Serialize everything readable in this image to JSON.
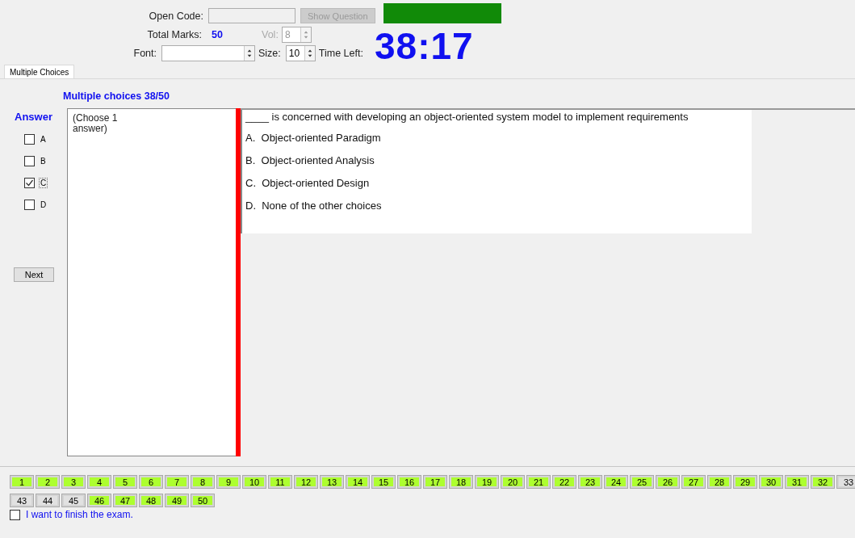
{
  "header": {
    "open_code": {
      "label": "Open Code:"
    },
    "show_question": {
      "label": "Show Question",
      "disabled": true
    },
    "total_marks": {
      "label": "Total Marks:",
      "value": "50"
    },
    "vol": {
      "label": "Vol:",
      "value": "8",
      "disabled": true
    },
    "font": {
      "label": "Font:"
    },
    "size": {
      "label": "Size:",
      "value": "10"
    },
    "time_left": {
      "label": "Time Left:",
      "value": "38:17"
    }
  },
  "tabs": [
    {
      "label": "Multiple Choices",
      "selected": true
    }
  ],
  "section_title": "Multiple choices 38/50",
  "answer": {
    "title": "Answer",
    "options": [
      {
        "letter": "A",
        "checked": false,
        "focused": false
      },
      {
        "letter": "B",
        "checked": false,
        "focused": false
      },
      {
        "letter": "C",
        "checked": true,
        "focused": true
      },
      {
        "letter": "D",
        "checked": false,
        "focused": false
      }
    ],
    "next_button": "Next"
  },
  "instruction": "(Choose 1 answer)",
  "question": {
    "text": "____ is concerned with developing an object-oriented system model to implement requirements",
    "choices": [
      {
        "letter": "A.",
        "text": "Object-oriented Paradigm"
      },
      {
        "letter": "B.",
        "text": "Object-oriented Analysis"
      },
      {
        "letter": "C.",
        "text": "Object-oriented Design"
      },
      {
        "letter": "D.",
        "text": "None of the other choices"
      }
    ]
  },
  "question_rows": [
    {
      "items": [
        {
          "label": "1",
          "answered": true
        },
        {
          "label": "2",
          "answered": true
        },
        {
          "label": "3",
          "answered": true
        },
        {
          "label": "4",
          "answered": true
        },
        {
          "label": "5",
          "answered": true
        },
        {
          "label": "6",
          "answered": true
        },
        {
          "label": "7",
          "answered": true
        },
        {
          "label": "8",
          "answered": true
        },
        {
          "label": "9",
          "answered": true
        },
        {
          "label": "10",
          "answered": true
        },
        {
          "label": "11",
          "answered": true
        },
        {
          "label": "12",
          "answered": true
        },
        {
          "label": "13",
          "answered": true
        },
        {
          "label": "14",
          "answered": true
        },
        {
          "label": "15",
          "answered": true
        },
        {
          "label": "16",
          "answered": true
        },
        {
          "label": "17",
          "answered": true
        },
        {
          "label": "18",
          "answered": true
        },
        {
          "label": "19",
          "answered": true
        },
        {
          "label": "20",
          "answered": true
        },
        {
          "label": "21",
          "answered": true
        },
        {
          "label": "22",
          "answered": true
        },
        {
          "label": "23",
          "answered": true
        },
        {
          "label": "24",
          "answered": true
        },
        {
          "label": "25",
          "answered": true
        },
        {
          "label": "26",
          "answered": true
        },
        {
          "label": "27",
          "answered": true
        },
        {
          "label": "28",
          "answered": true
        },
        {
          "label": "29",
          "answered": true
        },
        {
          "label": "30",
          "answered": true
        },
        {
          "label": "31",
          "answered": true
        },
        {
          "label": "32",
          "answered": true
        },
        {
          "label": "33",
          "answered": false
        }
      ]
    },
    {
      "items": [
        {
          "label": "43",
          "answered": false
        },
        {
          "label": "44",
          "answered": false
        },
        {
          "label": "45",
          "answered": false
        },
        {
          "label": "46",
          "answered": true
        },
        {
          "label": "47",
          "answered": true
        },
        {
          "label": "48",
          "answered": true
        },
        {
          "label": "49",
          "answered": true
        },
        {
          "label": "50",
          "answered": true
        }
      ]
    }
  ],
  "finish": {
    "label": "I want to finish the exam.",
    "checked": false
  }
}
